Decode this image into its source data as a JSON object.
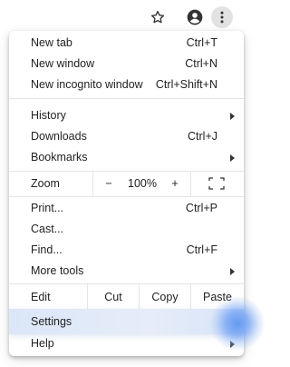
{
  "toolbar": {
    "icons": [
      "star-icon",
      "profile-icon",
      "more-vert-icon"
    ]
  },
  "menu": {
    "new_tab": {
      "label": "New tab",
      "shortcut": "Ctrl+T"
    },
    "new_window": {
      "label": "New window",
      "shortcut": "Ctrl+N"
    },
    "new_incognito": {
      "label": "New incognito window",
      "shortcut": "Ctrl+Shift+N"
    },
    "history": {
      "label": "History"
    },
    "downloads": {
      "label": "Downloads",
      "shortcut": "Ctrl+J"
    },
    "bookmarks": {
      "label": "Bookmarks"
    },
    "zoom": {
      "label": "Zoom",
      "minus": "−",
      "value": "100%",
      "plus": "+"
    },
    "print": {
      "label": "Print...",
      "shortcut": "Ctrl+P"
    },
    "cast": {
      "label": "Cast..."
    },
    "find": {
      "label": "Find...",
      "shortcut": "Ctrl+F"
    },
    "more_tools": {
      "label": "More tools"
    },
    "edit": {
      "label": "Edit",
      "cut": "Cut",
      "copy": "Copy",
      "paste": "Paste"
    },
    "settings": {
      "label": "Settings"
    },
    "help": {
      "label": "Help"
    }
  },
  "colors": {
    "highlight": "#dbe6f7",
    "accent": "#5f96f0"
  }
}
